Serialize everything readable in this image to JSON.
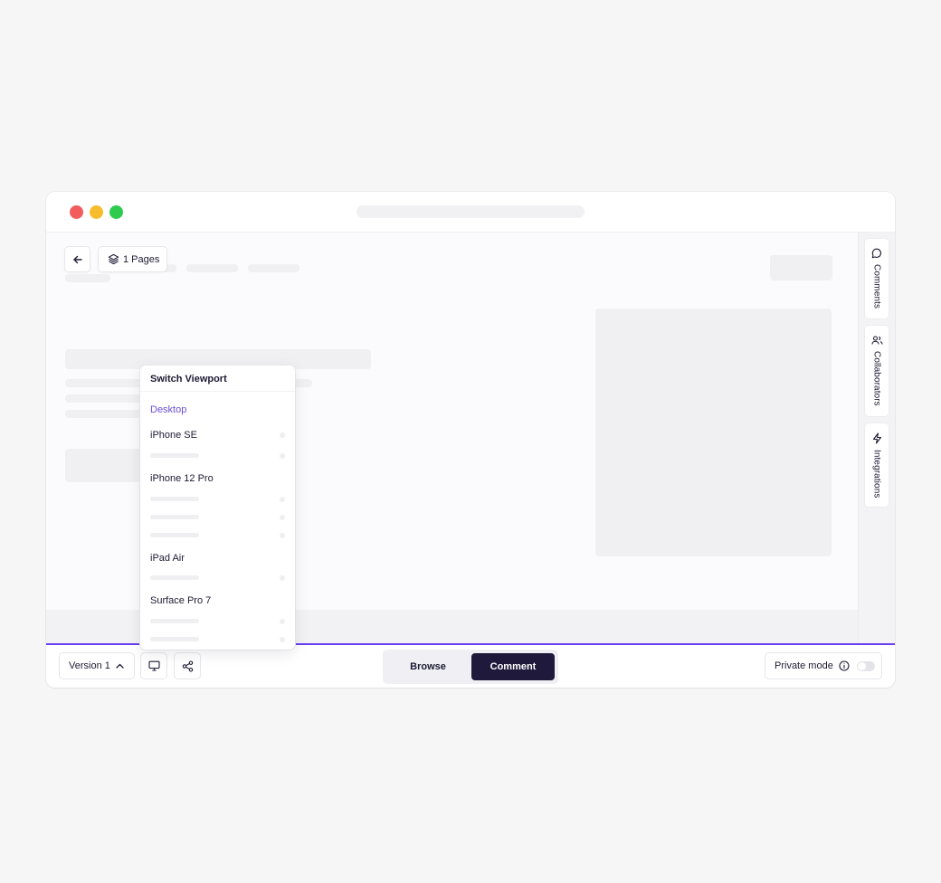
{
  "toolbar": {
    "pages_label": "1 Pages"
  },
  "side_tabs": [
    {
      "label": "Comments",
      "icon": "message-circle-icon"
    },
    {
      "label": "Collaborators",
      "icon": "users-icon"
    },
    {
      "label": "Integrations",
      "icon": "zap-icon"
    }
  ],
  "viewport_menu": {
    "title": "Switch Viewport",
    "items": [
      {
        "label": "Desktop",
        "selected": true
      },
      {
        "label": "iPhone SE"
      },
      {
        "label": "iPhone 12 Pro"
      },
      {
        "label": "iPad Air"
      },
      {
        "label": "Surface Pro 7"
      }
    ]
  },
  "bottom": {
    "version_label": "Version 1",
    "modes": [
      "Browse",
      "Comment"
    ],
    "active_mode": "Comment",
    "private_label": "Private mode",
    "private_enabled": false
  },
  "colors": {
    "accent": "#6a3df0",
    "selected_item": "#6a4fd8",
    "active_mode_bg": "#1f1a3b"
  }
}
